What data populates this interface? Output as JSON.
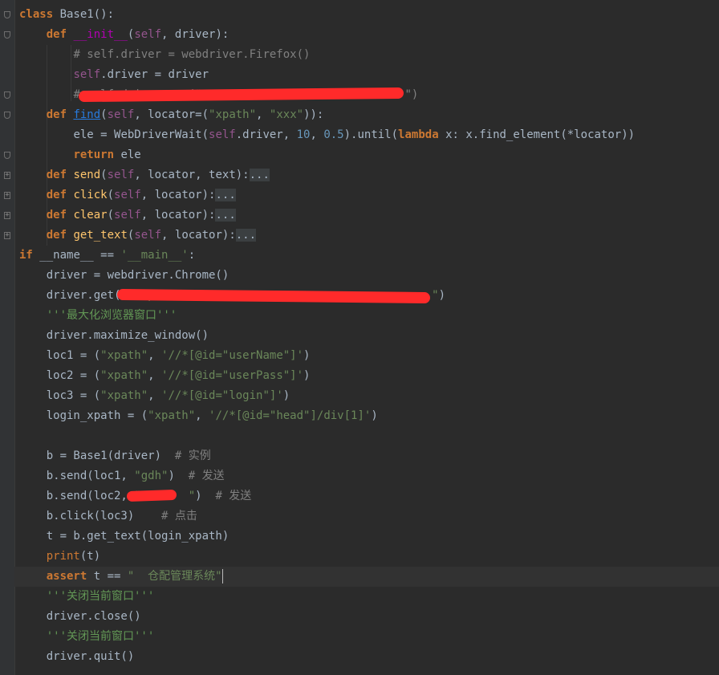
{
  "lines": [
    {
      "id": "l1",
      "segs": [
        [
          "kw",
          "class "
        ],
        [
          "",
          "Base1():"
        ]
      ]
    },
    {
      "id": "l2",
      "segs": [
        [
          "kw",
          "def "
        ],
        [
          "mag",
          "__init__"
        ],
        [
          "",
          "("
        ],
        [
          "self",
          "self"
        ],
        [
          "",
          ", driver):"
        ]
      ]
    },
    {
      "id": "l3",
      "segs": [
        [
          "cmt",
          "# self.driver = webdriver.Firefox()"
        ]
      ]
    },
    {
      "id": "l4",
      "segs": [
        [
          "self",
          "self"
        ],
        [
          "",
          ".driver = driver"
        ]
      ]
    },
    {
      "id": "l5",
      "segs": [
        [
          "cmt",
          "# self.driver.get(\""
        ],
        [
          "cmt",
          "                              "
        ],
        [
          "cmt",
          "\")"
        ]
      ]
    },
    {
      "id": "l6",
      "segs": [
        [
          "kw",
          "def "
        ],
        [
          "blue",
          "find"
        ],
        [
          "",
          "("
        ],
        [
          "self",
          "self"
        ],
        [
          "",
          ", locator=("
        ],
        [
          "str",
          "\"xpath\""
        ],
        [
          "",
          ", "
        ],
        [
          "str",
          "\"xxx\""
        ],
        [
          "",
          ")):"
        ]
      ]
    },
    {
      "id": "l7",
      "segs": [
        [
          "",
          "ele = WebDriverWait("
        ],
        [
          "self",
          "self"
        ],
        [
          "",
          ".driver, "
        ],
        [
          "num",
          "10"
        ],
        [
          "",
          ", "
        ],
        [
          "num",
          "0.5"
        ],
        [
          "",
          ").until("
        ],
        [
          "kw",
          "lambda "
        ],
        [
          "",
          "x: x.find_element(*locator))"
        ]
      ]
    },
    {
      "id": "l8",
      "segs": [
        [
          "kw",
          "return "
        ],
        [
          "",
          "ele"
        ]
      ]
    },
    {
      "id": "l9",
      "segs": [
        [
          "kw",
          "def "
        ],
        [
          "fn",
          "send"
        ],
        [
          "",
          "("
        ],
        [
          "self",
          "self"
        ],
        [
          "",
          ", locator, text):"
        ],
        [
          "fold-text",
          "..."
        ]
      ]
    },
    {
      "id": "l10",
      "segs": [
        [
          "kw",
          "def "
        ],
        [
          "fn",
          "click"
        ],
        [
          "",
          "("
        ],
        [
          "self",
          "self"
        ],
        [
          "",
          ", locator):"
        ],
        [
          "fold-text",
          "..."
        ]
      ]
    },
    {
      "id": "l11",
      "segs": [
        [
          "kw",
          "def "
        ],
        [
          "fn",
          "clear"
        ],
        [
          "",
          "("
        ],
        [
          "self",
          "self"
        ],
        [
          "",
          ", locator):"
        ],
        [
          "fold-text",
          "..."
        ]
      ]
    },
    {
      "id": "l12",
      "segs": [
        [
          "kw",
          "def "
        ],
        [
          "fn",
          "get_text"
        ],
        [
          "",
          "("
        ],
        [
          "self",
          "self"
        ],
        [
          "",
          ", locator):"
        ],
        [
          "fold-text",
          "..."
        ]
      ]
    },
    {
      "id": "l13",
      "segs": [
        [
          "kw",
          "if "
        ],
        [
          "",
          "__name__ == "
        ],
        [
          "str",
          "'__main__'"
        ],
        [
          "",
          ":"
        ]
      ]
    },
    {
      "id": "l14",
      "segs": [
        [
          "",
          "driver = webdriver.Chrome()"
        ]
      ]
    },
    {
      "id": "l15",
      "segs": [
        [
          "",
          "driver.get("
        ],
        [
          "str",
          "\"http://                                      \""
        ],
        [
          "",
          ")"
        ]
      ]
    },
    {
      "id": "l16",
      "segs": [
        [
          "doc",
          "'''最大化浏览器窗口'''"
        ]
      ]
    },
    {
      "id": "l17",
      "segs": [
        [
          "",
          "driver.maximize_window()"
        ]
      ]
    },
    {
      "id": "l18",
      "segs": [
        [
          "",
          "loc1 = ("
        ],
        [
          "str",
          "\"xpath\""
        ],
        [
          "",
          ", "
        ],
        [
          "str",
          "'//*[@id=\"userName\"]'"
        ],
        [
          "",
          ")"
        ]
      ]
    },
    {
      "id": "l19",
      "segs": [
        [
          "",
          "loc2 = ("
        ],
        [
          "str",
          "\"xpath\""
        ],
        [
          "",
          ", "
        ],
        [
          "str",
          "'//*[@id=\"userPass\"]'"
        ],
        [
          "",
          ")"
        ]
      ]
    },
    {
      "id": "l20",
      "segs": [
        [
          "",
          "loc3 = ("
        ],
        [
          "str",
          "\"xpath\""
        ],
        [
          "",
          ", "
        ],
        [
          "str",
          "'//*[@id=\"login\"]'"
        ],
        [
          "",
          ")"
        ]
      ]
    },
    {
      "id": "l21",
      "segs": [
        [
          "",
          "login_xpath = ("
        ],
        [
          "str",
          "\"xpath\""
        ],
        [
          "",
          ", "
        ],
        [
          "str",
          "'//*[@id=\"head\"]/div[1]'"
        ],
        [
          "",
          ")"
        ]
      ]
    },
    {
      "id": "l22",
      "segs": []
    },
    {
      "id": "l23",
      "segs": [
        [
          "",
          "b = Base1(driver)  "
        ],
        [
          "cmt",
          "# 实例"
        ]
      ]
    },
    {
      "id": "l24",
      "segs": [
        [
          "",
          "b.send(loc1, "
        ],
        [
          "str",
          "\"gdh\""
        ],
        [
          "",
          ")  "
        ],
        [
          "cmt",
          "# 发送"
        ]
      ]
    },
    {
      "id": "l25",
      "segs": [
        [
          "",
          "b.send(loc2, "
        ],
        [
          "str",
          "\"       \""
        ],
        [
          "",
          ")  "
        ],
        [
          "cmt",
          "# 发送"
        ]
      ]
    },
    {
      "id": "l26",
      "segs": [
        [
          "",
          "b.click(loc3)    "
        ],
        [
          "cmt",
          "# 点击"
        ]
      ]
    },
    {
      "id": "l27",
      "segs": [
        [
          "",
          "t = b.get_text(login_xpath)"
        ]
      ]
    },
    {
      "id": "l28",
      "segs": [
        [
          "kwn",
          "print"
        ],
        [
          "",
          "(t)"
        ]
      ]
    },
    {
      "id": "l29",
      "segs": [
        [
          "kw",
          "assert "
        ],
        [
          "",
          "t == "
        ],
        [
          "str",
          "\"  仓配管理系统\""
        ]
      ]
    },
    {
      "id": "l30",
      "segs": [
        [
          "doc",
          "'''关闭当前窗口'''"
        ]
      ]
    },
    {
      "id": "l31",
      "segs": [
        [
          "",
          "driver.close()"
        ]
      ]
    },
    {
      "id": "l32",
      "segs": [
        [
          "doc",
          "'''关闭当前窗口'''"
        ]
      ]
    },
    {
      "id": "l33",
      "segs": [
        [
          "",
          "driver.quit()"
        ]
      ]
    }
  ]
}
